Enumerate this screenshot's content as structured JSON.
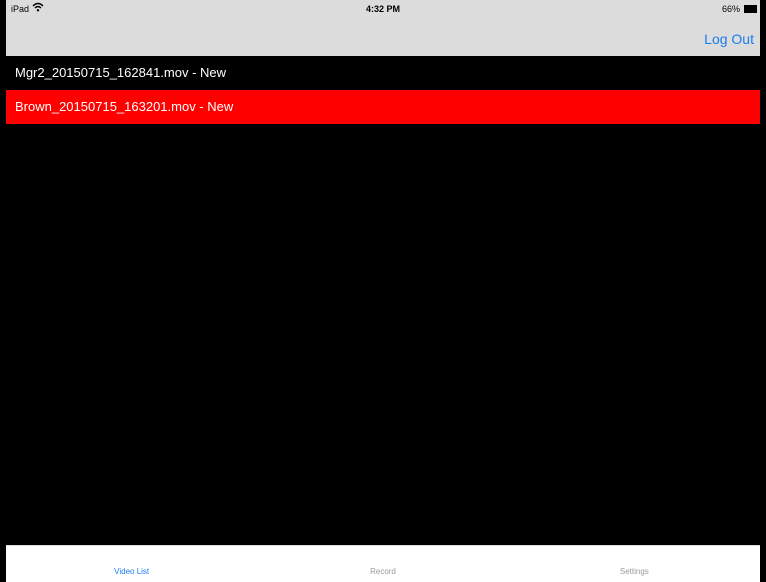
{
  "status_bar": {
    "device": "iPad",
    "wifi_icon": "wifi-icon",
    "time": "4:32 PM",
    "battery_percent": "66%",
    "battery_icon": "battery-icon"
  },
  "nav": {
    "logout_label": "Log Out"
  },
  "videos": [
    {
      "label": "Mgr2_20150715_162841.mov - New",
      "selected": false
    },
    {
      "label": "Brown_20150715_163201.mov - New",
      "selected": true
    }
  ],
  "tabs": [
    {
      "label": "Video List",
      "active": true
    },
    {
      "label": "Record",
      "active": false
    },
    {
      "label": "Settings",
      "active": false
    }
  ],
  "colors": {
    "accent": "#1a7cf0",
    "selected_row": "#ff0000",
    "list_background": "#000000",
    "navbar_background": "#dcdcdc"
  }
}
